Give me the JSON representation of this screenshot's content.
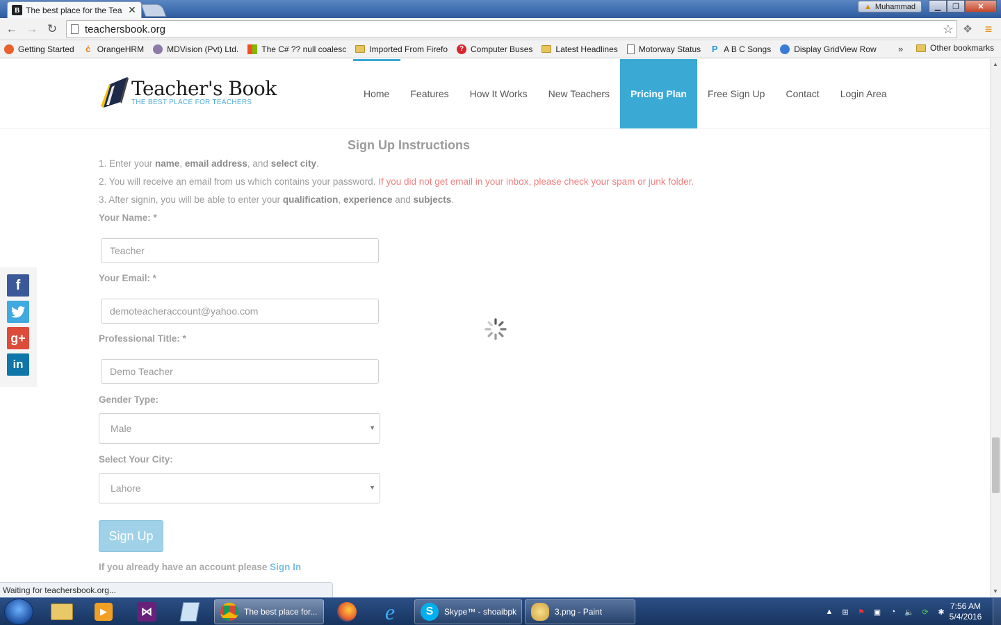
{
  "browser": {
    "tab_title": "The best place for the Tea",
    "tab_favicon": "B",
    "profile_name": "Muhammad",
    "url": "teachersbook.org",
    "bookmarks": [
      {
        "label": "Getting Started",
        "icon": "firefox-icon"
      },
      {
        "label": "OrangeHRM",
        "icon": "orange-icon"
      },
      {
        "label": "MDVision (Pvt) Ltd.",
        "icon": "mdvision-icon"
      },
      {
        "label": "The C# ?? null coalesc",
        "icon": "microsoft-icon"
      },
      {
        "label": "Imported From Firefo",
        "icon": "folder-icon"
      },
      {
        "label": "Computer Buses",
        "icon": "question-icon"
      },
      {
        "label": "Latest Headlines",
        "icon": "folder-icon"
      },
      {
        "label": "Motorway Status",
        "icon": "page-icon"
      },
      {
        "label": "A B C Songs",
        "icon": "p-icon"
      },
      {
        "label": "Display GridView Row",
        "icon": "asp-icon"
      }
    ],
    "bookmarks_more": "»",
    "other_bookmarks": "Other bookmarks",
    "status_text": "Waiting for teachersbook.org..."
  },
  "site": {
    "logo_name": "Teacher's Book",
    "logo_tagline": "THE BEST PLACE FOR TEACHERS",
    "menu": [
      "Home",
      "Features",
      "How It Works",
      "New Teachers",
      "Pricing Plan",
      "Free Sign Up",
      "Contact",
      "Login Area"
    ],
    "active_menu": "Pricing Plan"
  },
  "form": {
    "instructions_title": "Sign Up Instructions",
    "step1": {
      "prefix": "1. Enter your ",
      "b1": "name",
      "sep1": ", ",
      "b2": "email address",
      "sep2": ", and ",
      "b3": "select city",
      "suffix": "."
    },
    "step2": {
      "text": "2. You will receive an email from us which contains your password. ",
      "warning": "If you did not get email in your inbox, please check your spam or junk folder."
    },
    "step3": {
      "prefix": "3. After signin, you will be able to enter your ",
      "b1": "qualification",
      "sep1": ", ",
      "b2": "experience",
      "sep2": " and ",
      "b3": "subjects",
      "suffix": "."
    },
    "name_label": "Your Name: *",
    "name_value": "Teacher",
    "email_label": "Your Email: *",
    "email_value": "demoteacheraccount@yahoo.com",
    "title_label": "Professional Title: *",
    "title_value": "Demo Teacher",
    "gender_label": "Gender Type:",
    "gender_value": "Male",
    "city_label": "Select Your City:",
    "city_value": "Lahore",
    "submit_label": "Sign Up",
    "signin_prompt": "If you already have an account please ",
    "signin_link": "Sign In"
  },
  "social": [
    "facebook-icon",
    "twitter-icon",
    "google-plus-icon",
    "linkedin-icon"
  ],
  "taskbar": {
    "tasks": [
      {
        "label": "The best place for...",
        "icon": "chrome-icon"
      },
      {
        "label": "Skype™ - shoaibpk",
        "icon": "skype-icon"
      },
      {
        "label": "3.png - Paint",
        "icon": "paint-icon"
      }
    ],
    "time": "7:56 AM",
    "date": "5/4/2016"
  },
  "colors": {
    "accent": "#3aa9d4",
    "warning_text": "#f08080",
    "button": "#9fd2e8"
  }
}
